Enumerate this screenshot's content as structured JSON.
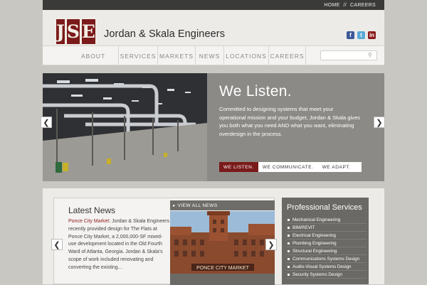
{
  "top_links": {
    "home": "HOME",
    "separator": "//",
    "careers": "CAREERS"
  },
  "logo": {
    "letters": [
      "J",
      "S",
      "E"
    ]
  },
  "company_name": "Jordan & Skala Engineers",
  "social": [
    {
      "icon": "facebook-icon",
      "label": "f",
      "color": "#3b5998"
    },
    {
      "icon": "twitter-icon",
      "label": "t",
      "color": "#5aa9d6"
    },
    {
      "icon": "linkedin-icon",
      "label": "in",
      "color": "#8a1a1a"
    }
  ],
  "nav": {
    "items": [
      "ABOUT",
      "SERVICES",
      "MARKETS",
      "NEWS",
      "LOCATIONS",
      "CAREERS"
    ],
    "search_placeholder": ""
  },
  "slider": {
    "title": "We Listen.",
    "text": "Committed to designing systems that meet your operational mission and your budget, Jordan & Skala gives you both what you need AND what you want, eliminating overdesign in the process.",
    "tabs": [
      "WE LISTEN.",
      "WE COMMUNICATE.",
      "WE ADAPT."
    ],
    "active_tab": 0
  },
  "news": {
    "title": "Latest News",
    "highlight": "Ponce City Market",
    "body": ": Jordan & Skala Engineers recently provided design for The Flats at Ponce City Market, a 2,000,000-SF mixed-use development located in the Old Fourth Ward of Atlanta, Georgia.  Jordan & Skala's scope of work included renovating and converting the existing...",
    "view_all": "VIEW ALL NEWS",
    "photo_sign": "PONCE CITY MARKET"
  },
  "services": {
    "title": "Professional Services",
    "items": [
      "Mechanical Engineering",
      "BIM/REVIT",
      "Electrical Engineering",
      "Plumbing Engineering",
      "Structural Engineering",
      "Communications Systems Design",
      "Audio-Visual Systems Design",
      "Security Systems Design"
    ]
  },
  "colors": {
    "brand": "#7a1a1a",
    "topbar": "#3a3a38",
    "panel": "#6a6966"
  }
}
